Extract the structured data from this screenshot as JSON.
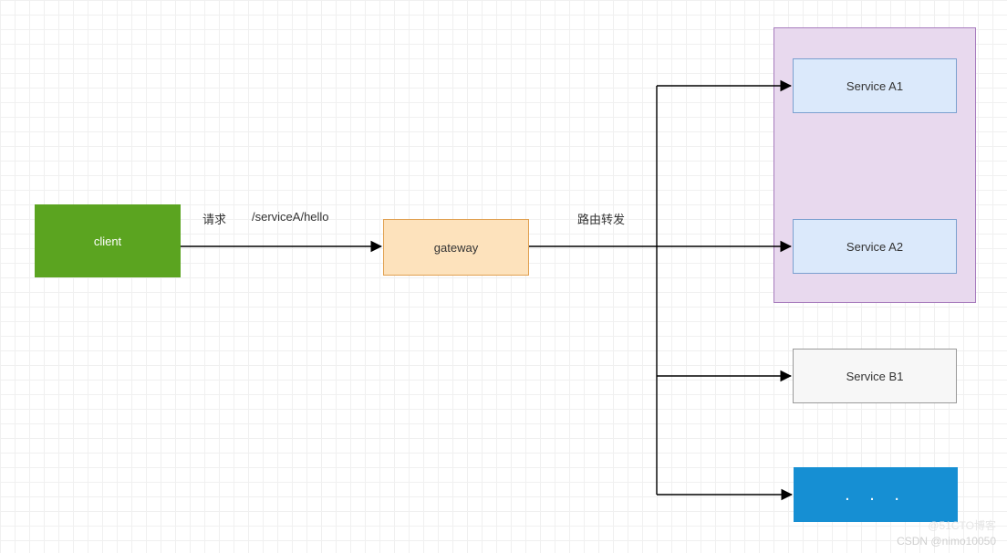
{
  "nodes": {
    "client": {
      "label": "client",
      "fill": "#5ba420",
      "stroke": "#5ba420",
      "text": "#ffffff"
    },
    "gateway": {
      "label": "gateway",
      "fill": "#fde2bc",
      "stroke": "#e0a050",
      "text": "#333333"
    },
    "serviceA1": {
      "label": "Service A1",
      "fill": "#dbe9fb",
      "stroke": "#7ba0cf",
      "text": "#333333"
    },
    "serviceA2": {
      "label": "Service A2",
      "fill": "#dbe9fb",
      "stroke": "#7ba0cf",
      "text": "#333333"
    },
    "serviceB1": {
      "label": "Service B1",
      "fill": "#f7f7f7",
      "stroke": "#999999",
      "text": "#333333"
    },
    "more": {
      "label": ". . .",
      "fill": "#168fd3",
      "stroke": "#168fd3",
      "text": "#ffffff"
    },
    "groupA": {
      "fill": "#e8d9ee",
      "stroke": "#a77cbd"
    }
  },
  "edges": {
    "clientToGateway": {
      "label_left": "请求",
      "label_right": "/serviceA/hello"
    },
    "gatewayFanout": {
      "label": "路由转发"
    }
  },
  "watermark1": "CSDN @nimo10050",
  "watermark2": "@51CTO博客"
}
